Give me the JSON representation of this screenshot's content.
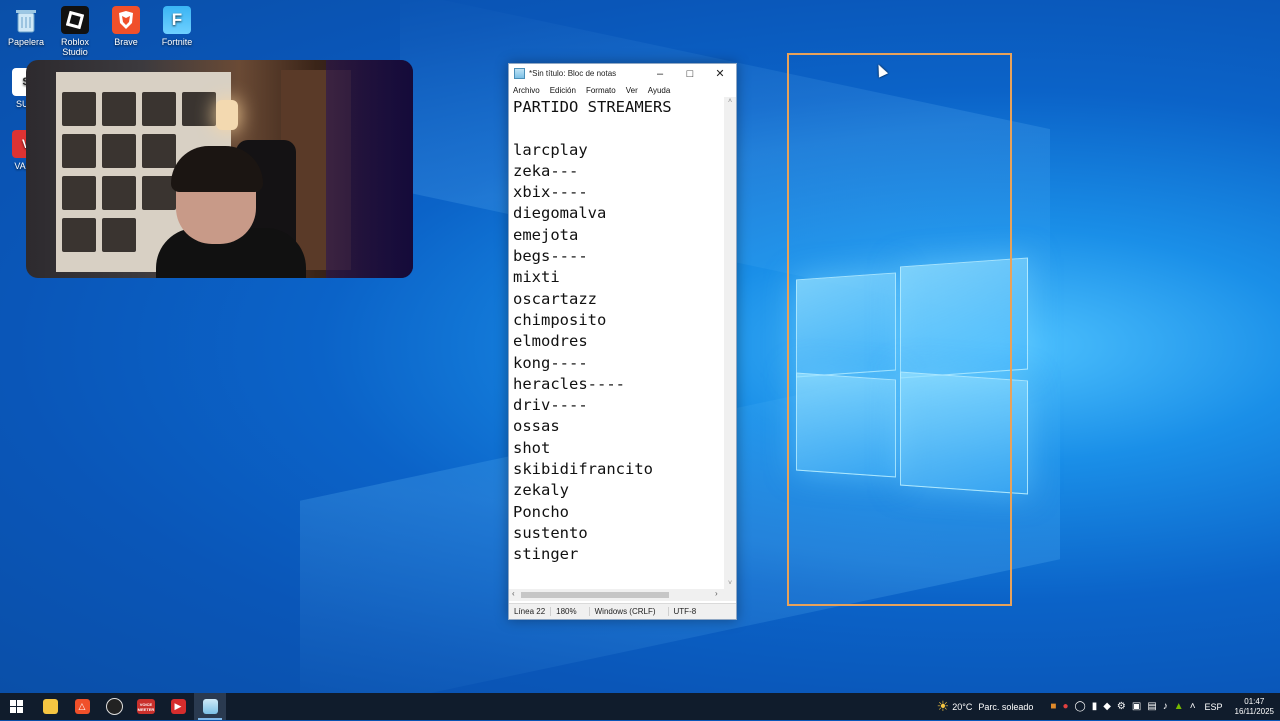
{
  "desktop": {
    "icons": [
      {
        "label": "Papelera",
        "icon": "recycle-bin-icon"
      },
      {
        "label": "Roblox\nStudio",
        "icon": "roblox-studio-icon"
      },
      {
        "label": "Brave",
        "icon": "brave-icon"
      },
      {
        "label": "Fortnite",
        "icon": "fortnite-icon"
      },
      {
        "label": "SUM",
        "icon": "sum-app-icon"
      },
      {
        "label": "VALO",
        "icon": "valorant-icon"
      }
    ]
  },
  "notepad": {
    "title": "*Sin título: Bloc de notas",
    "menu": [
      "Archivo",
      "Edición",
      "Formato",
      "Ver",
      "Ayuda"
    ],
    "lines": [
      "PARTIDO STREAMERS",
      "",
      "larcplay",
      "zeka---",
      "xbix----",
      "diegomalva",
      "emejota",
      "begs----",
      "mixti",
      "oscartazz",
      "chimposito",
      "elmodres",
      "kong----",
      "heracles----",
      "driv----",
      "ossas",
      "shot",
      "skibidifrancito",
      "zekaly",
      "Poncho",
      "sustento",
      "stinger"
    ],
    "status": {
      "position": "Línea 22",
      "zoom": "180%",
      "line_ending": "Windows (CRLF)",
      "encoding": "UTF-8"
    }
  },
  "taskbar": {
    "apps": [
      "start-icon",
      "file-explorer-icon",
      "brave-icon",
      "obs-icon",
      "voicemeeter-icon",
      "streaming-app-icon",
      "notepad-icon"
    ],
    "voicemeeter_label": "VOICE\nMEETER",
    "weather": {
      "temp": "20°C",
      "desc": "Parc. soleado"
    },
    "language": "ESP",
    "time": "01:47",
    "date": "16/11/2025"
  },
  "colors": {
    "accent": "#e8a25a",
    "taskbar": "#101c2c",
    "desktop": "#0b63c8"
  }
}
